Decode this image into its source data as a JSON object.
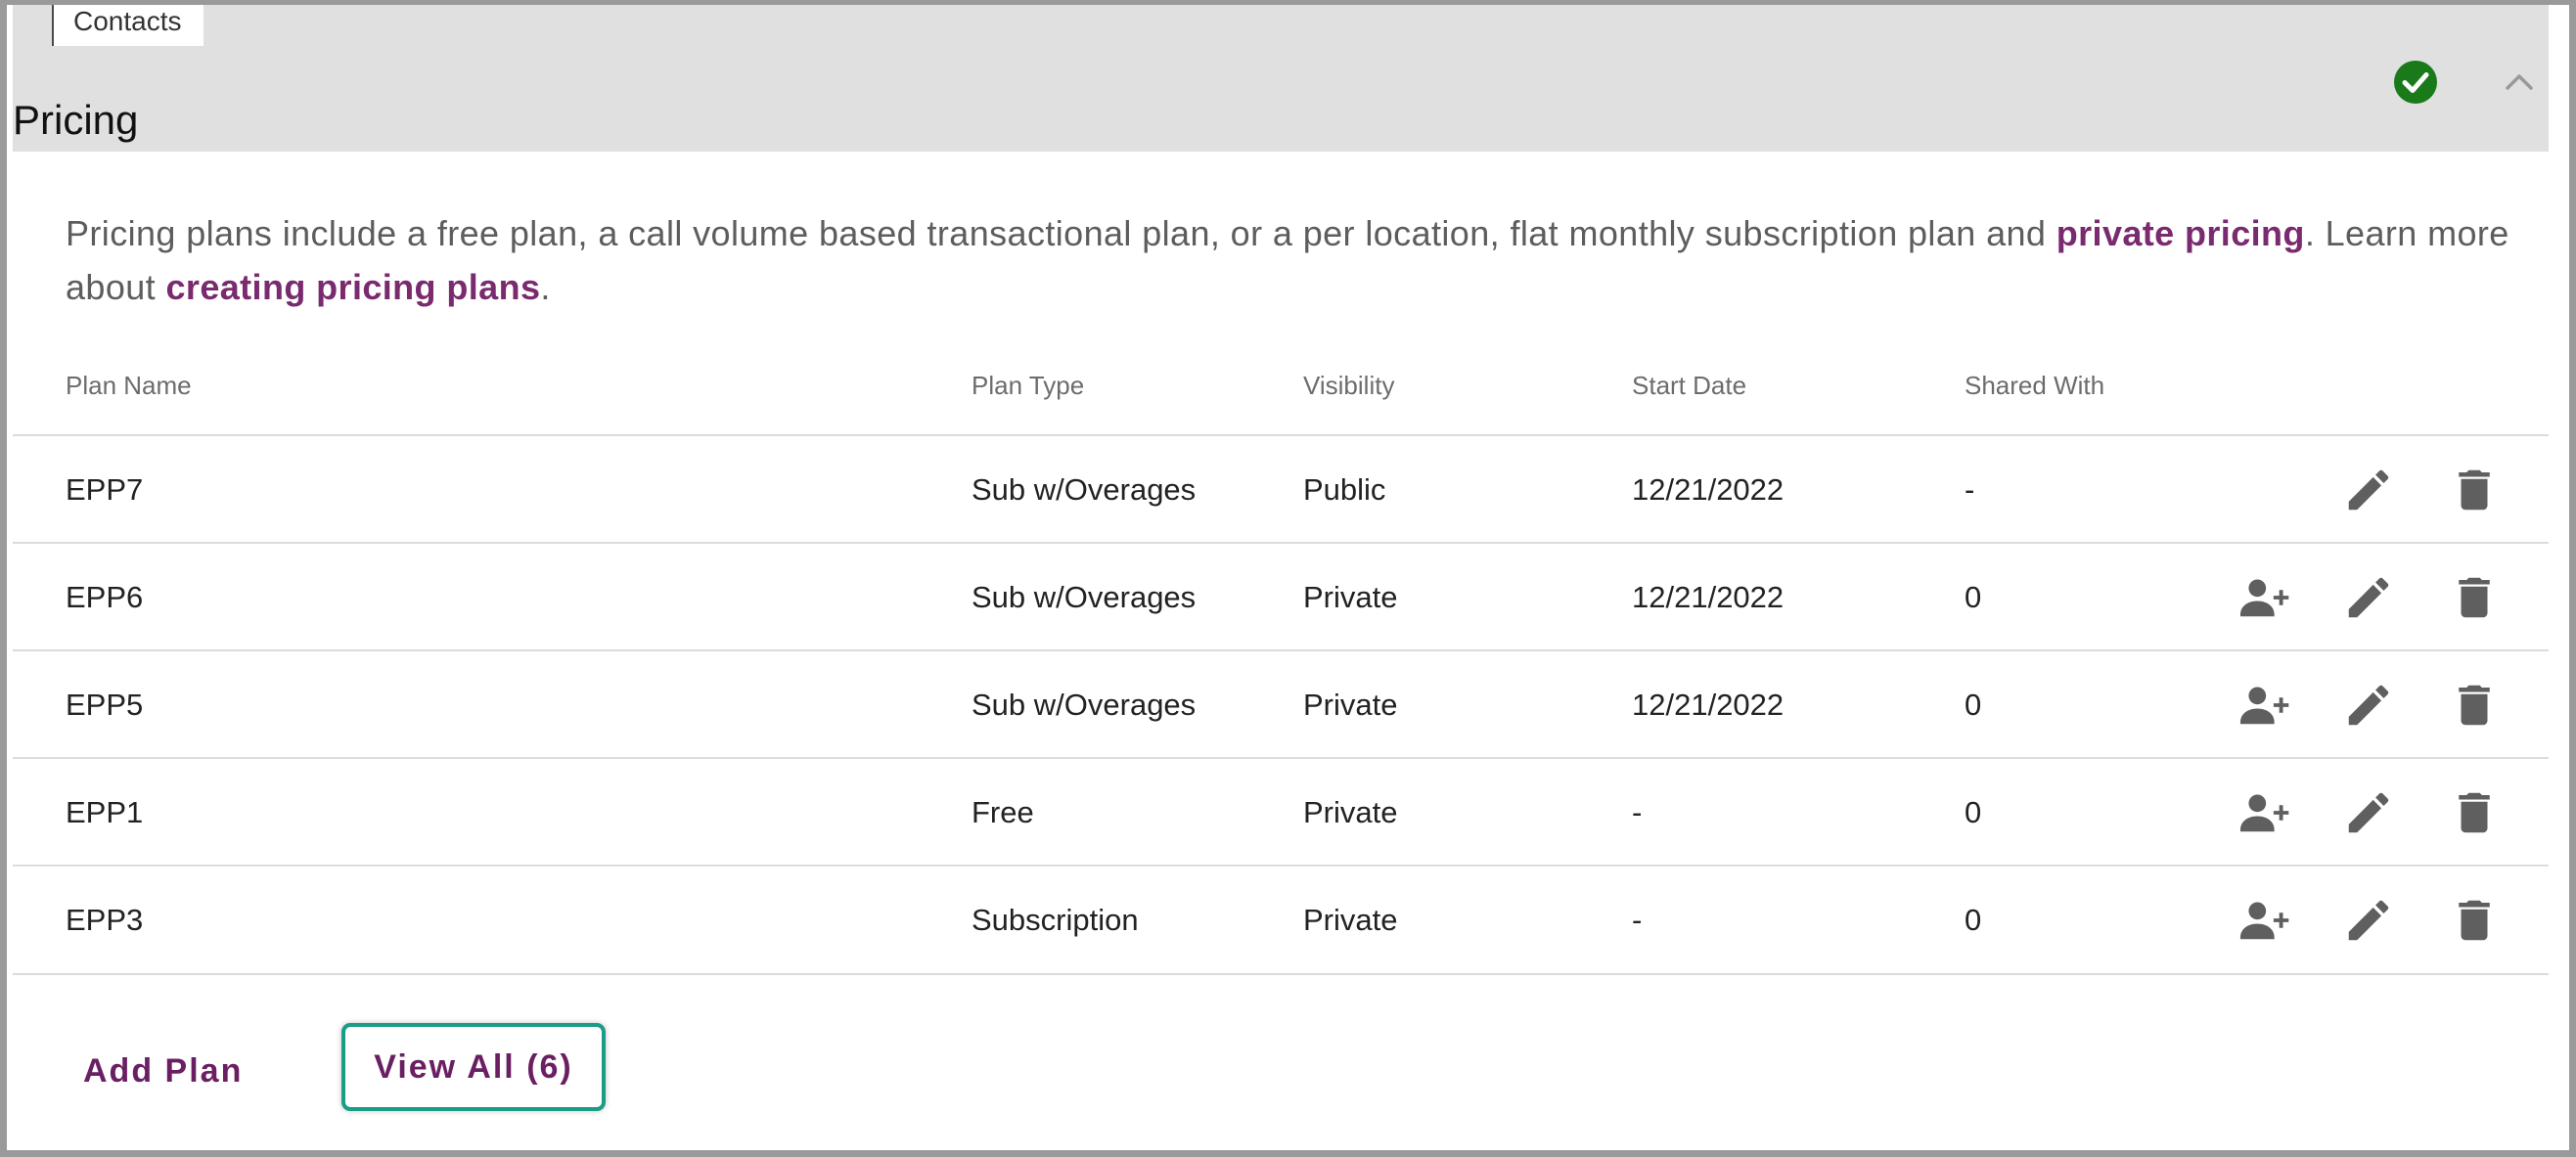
{
  "tab": {
    "label": "Contacts"
  },
  "section": {
    "title": "Pricing",
    "status_icon": "check-circle-icon",
    "status_color": "#1a7a1a",
    "collapse_icon": "chevron-up-icon"
  },
  "intro": {
    "text_before": "Pricing plans include a free plan, a call volume based transactional plan, or a per location, flat monthly subscription plan and ",
    "link_private": "private pricing",
    "text_middle": ". Learn more about ",
    "link_creating": "creating pricing plans",
    "text_after": "."
  },
  "table": {
    "headers": {
      "plan_name": "Plan Name",
      "plan_type": "Plan Type",
      "visibility": "Visibility",
      "start_date": "Start Date",
      "shared_with": "Shared With"
    },
    "rows": [
      {
        "name": "EPP7",
        "type": "Sub w/Overages",
        "visibility": "Public",
        "start": "12/21/2022",
        "shared": "-"
      },
      {
        "name": "EPP6",
        "type": "Sub w/Overages",
        "visibility": "Private",
        "start": "12/21/2022",
        "shared": "0"
      },
      {
        "name": "EPP5",
        "type": "Sub w/Overages",
        "visibility": "Private",
        "start": "12/21/2022",
        "shared": "0"
      },
      {
        "name": "EPP1",
        "type": "Free",
        "visibility": "Private",
        "start": "-",
        "shared": "0"
      },
      {
        "name": "EPP3",
        "type": "Subscription",
        "visibility": "Private",
        "start": "-",
        "shared": "0"
      }
    ],
    "action_icons": [
      "add-user-icon",
      "edit-pencil-icon",
      "trash-icon"
    ]
  },
  "actions": {
    "add_plan": "Add Plan",
    "view_all": "View All (6)"
  },
  "colors": {
    "accent_link": "#7a2a6e",
    "button_text": "#6b1f63",
    "focus_ring": "#1a9c86",
    "header_bg": "#e0e0e0"
  }
}
